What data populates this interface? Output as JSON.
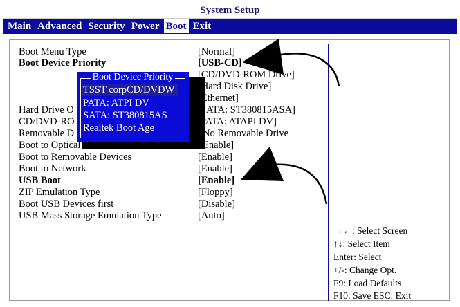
{
  "title": "System Setup",
  "menu": [
    {
      "label": "Main",
      "active": false
    },
    {
      "label": "Advanced",
      "active": false
    },
    {
      "label": "Security",
      "active": false
    },
    {
      "label": "Power",
      "active": false
    },
    {
      "label": "Boot",
      "active": true
    },
    {
      "label": "Exit",
      "active": false
    }
  ],
  "settings": [
    {
      "label": "Boot Menu Type",
      "value": "[Normal]",
      "bold": false
    },
    {
      "label": "Boot Device Priority",
      "value": "[USB-CD]",
      "bold": true
    },
    {
      "label": "",
      "value": "[CD/DVD-ROM Drive]",
      "bold": false
    },
    {
      "label": "",
      "value": "[Hard Disk Drive]",
      "bold": false
    },
    {
      "label": "",
      "value": "[Ethernet]",
      "bold": false
    },
    {
      "label": "Hard Drive O",
      "value": "SATA:  ST380815ASA]",
      "bold": false
    },
    {
      "label": "CD/DVD-RO",
      "value": "PATA:  ATAPI    DV]",
      "bold": false
    },
    {
      "label": "Removable D",
      "value": "No Removable Drive",
      "bold": false
    },
    {
      "label": "Boot to Optical",
      "value": "Enable]",
      "bold": false
    },
    {
      "label": "Boot to Removable Devices",
      "value": "[Enable]",
      "bold": false
    },
    {
      "label": "Boot to Network",
      "value": "[Enable]",
      "bold": false
    },
    {
      "label": "USB Boot",
      "value": "[Enable]",
      "bold": true
    },
    {
      "label": "ZIP Emulation Type",
      "value": "[Floppy]",
      "bold": false
    },
    {
      "label": "Boot USB Devices first",
      "value": "[Disable]",
      "bold": false
    },
    {
      "label": "USB Mass Storage Emulation Type",
      "value": "[Auto]",
      "bold": false
    }
  ],
  "popup": {
    "title": "Boot Device Priority",
    "items": [
      "TSST corpCD/DVDW",
      "PATA: ATPI DV",
      "SATA: ST380815AS",
      "Realtek Boot Age"
    ],
    "selected_index": 0
  },
  "help": [
    "→←: Select Screen",
    "↑↓: Select Item",
    "Enter:  Select",
    "+/-:  Change Opt.",
    "F9:  Load Defaults",
    "F10:  Save  ESC: Exit"
  ],
  "colors": {
    "menubar": "#0b0b9e",
    "popup": "#0b0bd8",
    "text": "#000000"
  }
}
